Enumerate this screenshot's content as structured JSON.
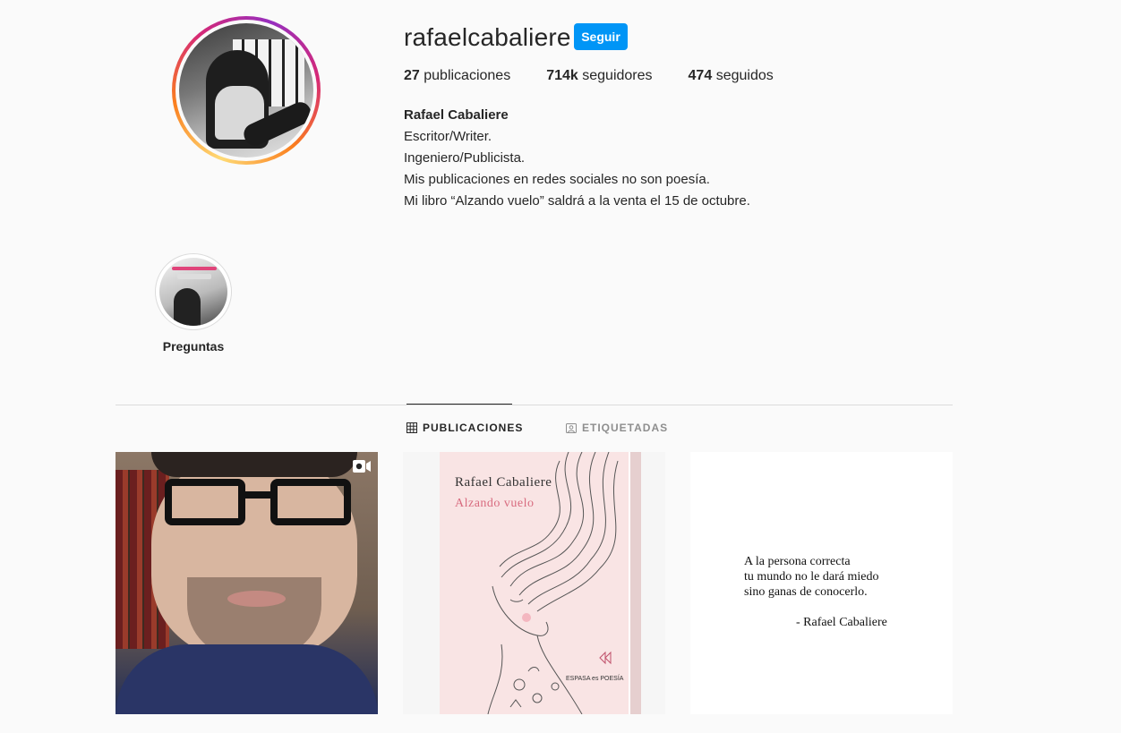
{
  "profile": {
    "username": "rafaelcabaliere",
    "follow_label": "Seguir",
    "stats": [
      {
        "value": "27",
        "label": "publicaciones"
      },
      {
        "value": "714k",
        "label": "seguidores"
      },
      {
        "value": "474",
        "label": "seguidos"
      }
    ],
    "full_name": "Rafael Cabaliere",
    "bio_lines": [
      "Escritor/Writer.",
      "Ingeniero/Publicista.",
      "Mis publicaciones en redes sociales no son poesía.",
      "Mi libro “Alzando vuelo” saldrá a la venta el 15 de octubre."
    ]
  },
  "highlights": [
    {
      "label": "Preguntas"
    }
  ],
  "tabs": [
    {
      "label": "PUBLICACIONES",
      "icon": "grid-icon",
      "active": true
    },
    {
      "label": "ETIQUETADAS",
      "icon": "tagged-icon",
      "active": false
    }
  ],
  "posts": [
    {
      "type": "video",
      "icon": "video-icon"
    },
    {
      "type": "image",
      "book_author": "Rafael Cabaliere",
      "book_title": "Alzando vuelo",
      "publisher": "ESPASA es POESÍA"
    },
    {
      "type": "image",
      "quote_lines": [
        "A la persona correcta",
        "tu mundo no le dará miedo",
        "sino ganas de conocerlo."
      ],
      "quote_author": "- Rafael Cabaliere"
    }
  ],
  "colors": {
    "follow_button": "#0095f6",
    "background": "#fafafa",
    "story_ring": "#d62976"
  }
}
